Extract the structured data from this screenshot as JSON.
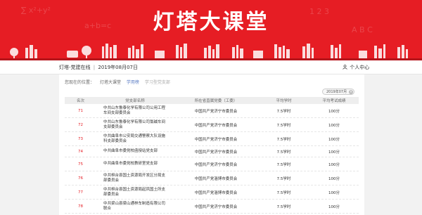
{
  "banner": {
    "title": "灯塔大课堂"
  },
  "infobar": {
    "site": "灯塔-党建在线",
    "separator": "|",
    "date": "2019年08月07日",
    "personal": "个人中心"
  },
  "breadcrumb": {
    "label": "您现在的位置：",
    "home": "灯塔大课堂",
    "section": "学用榜",
    "current": "学习型党支部"
  },
  "date_filter": {
    "value": "2019年07月"
  },
  "table": {
    "headers": [
      "名次",
      "党支部名称",
      "所在省直属党委（工委）",
      "平均学时",
      "平均考试成绩"
    ],
    "rows": [
      {
        "rank": "71",
        "name": "中共山东鲁泰化学有限公司公用工程车间支部委员会",
        "committee": "中国共产党济宁市委员会",
        "hours": "7.5学时",
        "score": "100分"
      },
      {
        "rank": "72",
        "name": "中共山东鲁泰化学有限公司氯碱车间支部委员会",
        "committee": "中国共产党济宁市委员会",
        "hours": "7.5学时",
        "score": "100分"
      },
      {
        "rank": "73",
        "name": "中共曲阜市公安局交通警察大队设施科支部委员会",
        "committee": "中国共产党济宁市委员会",
        "hours": "7.5学时",
        "score": "100分"
      },
      {
        "rank": "74",
        "name": "中共曲阜市委党校函授站党支部",
        "committee": "中国共产党济宁市委员会",
        "hours": "7.5学时",
        "score": "100分"
      },
      {
        "rank": "75",
        "name": "中共曲阜市委党校教研室党支部",
        "committee": "中国共产党济宁市委员会",
        "hours": "7.5学时",
        "score": "100分"
      },
      {
        "rank": "76",
        "name": "中共桓台县国土资源局开发区分局支部委员会",
        "committee": "中国共产党淄博市委员会",
        "hours": "7.5学时",
        "score": "100分"
      },
      {
        "rank": "77",
        "name": "中共桓台县国土资源局起凤国土所支部委员会",
        "committee": "中国共产党淄博市委员会",
        "hours": "7.5学时",
        "score": "100分"
      },
      {
        "rank": "78",
        "name": "中共梁山县梁山通林车制造有限公司联合",
        "committee": "中国共产党济宁市委员会",
        "hours": "7.5学时",
        "score": "100分"
      }
    ]
  }
}
